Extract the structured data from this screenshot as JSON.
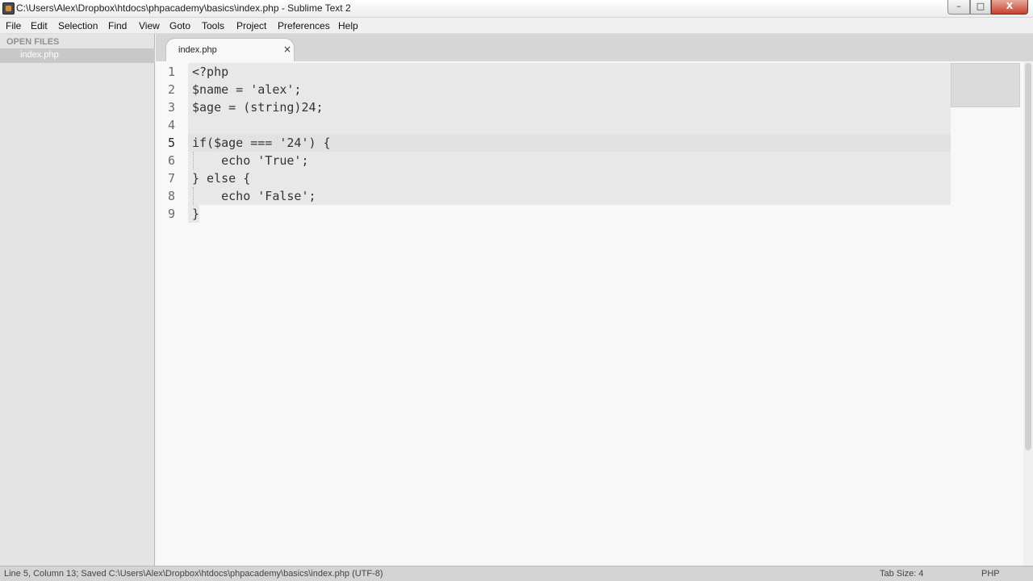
{
  "window": {
    "title": "C:\\Users\\Alex\\Dropbox\\htdocs\\phpacademy\\basics\\index.php - Sublime Text 2",
    "minimize_glyph": "–",
    "maximize_glyph": "□",
    "close_glyph": "X"
  },
  "menu": [
    "File",
    "Edit",
    "Selection",
    "Find",
    "View",
    "Goto",
    "Tools",
    "Project",
    "Preferences",
    "Help"
  ],
  "sidebar": {
    "header": "OPEN FILES",
    "files": [
      "index.php"
    ]
  },
  "tabs": [
    {
      "label": "index.php",
      "close_glyph": "×"
    }
  ],
  "editor": {
    "line_numbers": [
      "1",
      "2",
      "3",
      "4",
      "5",
      "6",
      "7",
      "8",
      "9"
    ],
    "current_line": 5,
    "code": [
      "<?php",
      "$name = 'alex';",
      "$age = (string)24;",
      "",
      "if($age === '24') {",
      "    echo 'True';",
      "} else {",
      "    echo 'False';",
      "}"
    ]
  },
  "status": {
    "left": "Line 5, Column 13; Saved C:\\Users\\Alex\\Dropbox\\htdocs\\phpacademy\\basics\\index.php (UTF-8)",
    "tab_size": "Tab Size: 4",
    "syntax": "PHP"
  },
  "colors": {
    "sidebar_bg": "#e4e4e4",
    "editor_bg": "#f8f8f8",
    "selection_band": "#e8e8e8",
    "close_button": "#c4412b"
  },
  "icons": [
    "app-icon",
    "minimize-icon",
    "maximize-icon",
    "close-icon",
    "tab-close-icon"
  ]
}
